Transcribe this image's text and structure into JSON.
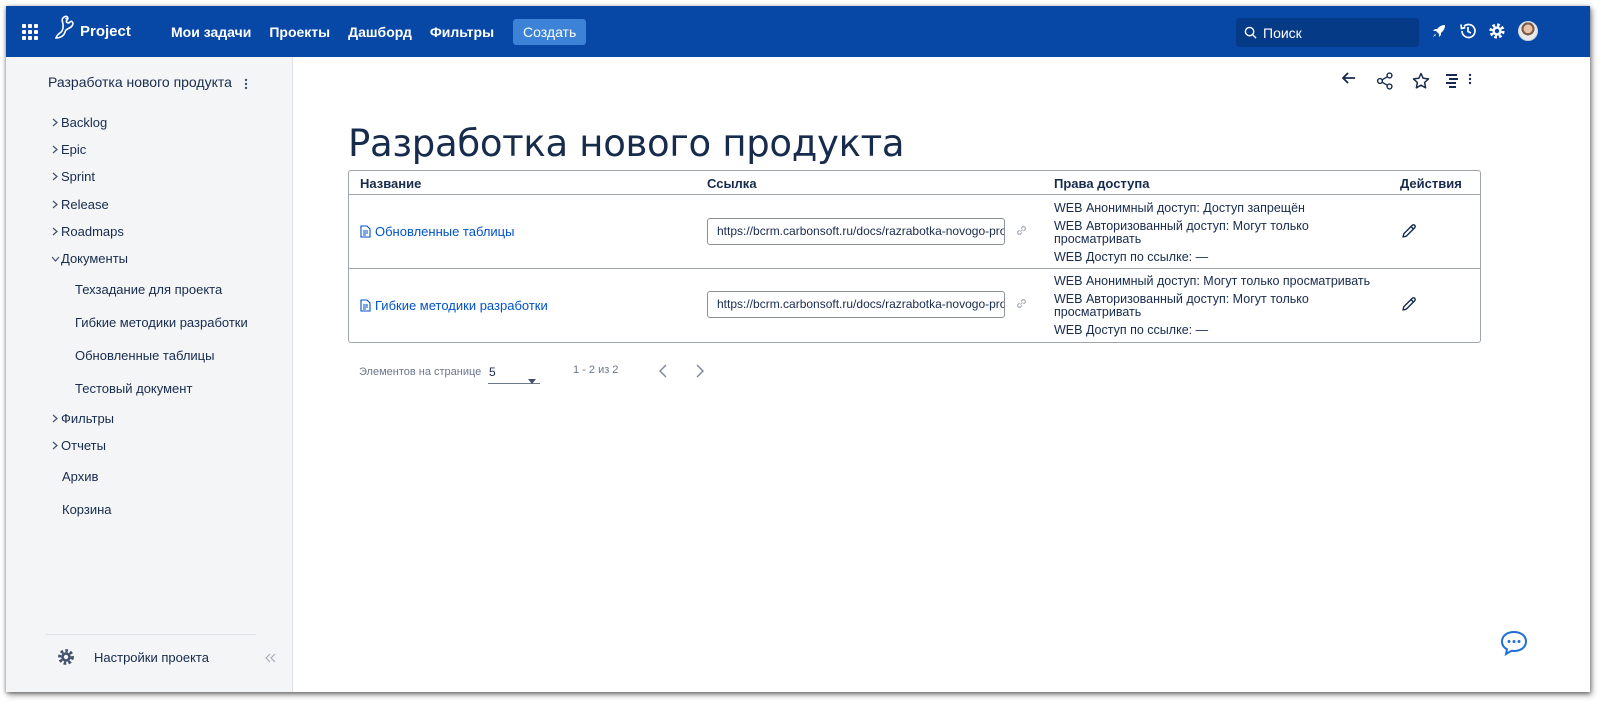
{
  "topbar": {
    "app_name": "Project",
    "nav": [
      "Мои задачи",
      "Проекты",
      "Дашборд",
      "Фильтры"
    ],
    "create_label": "Создать",
    "search_placeholder": "Поиск",
    "icons": [
      "apps-grid-icon",
      "rocket-icon",
      "history-icon",
      "gear-icon",
      "avatar"
    ],
    "colors": {
      "bar": "#0747a6",
      "create": "#3c82d6"
    }
  },
  "sidebar": {
    "project_title": "Разработка нового продукта",
    "tree": [
      {
        "label": "Backlog",
        "expanded": false
      },
      {
        "label": "Epic",
        "expanded": false
      },
      {
        "label": "Sprint",
        "expanded": false
      },
      {
        "label": "Release",
        "expanded": false
      },
      {
        "label": "Roadmaps",
        "expanded": false
      },
      {
        "label": "Документы",
        "expanded": true
      }
    ],
    "documents": [
      "Техзадание для проекта",
      "Гибкие методики разработки",
      "Обновленные таблицы",
      "Тестовый документ"
    ],
    "tree_after": [
      {
        "label": "Фильтры",
        "expanded": false
      },
      {
        "label": "Отчеты",
        "expanded": false
      }
    ],
    "plain": [
      "Архив",
      "Корзина"
    ],
    "settings_label": "Настройки проекта"
  },
  "main": {
    "title": "Разработка нового продукта",
    "toolbar_icons": [
      "back-arrow-icon",
      "share-icon",
      "star-icon",
      "list-view-icon",
      "more-vertical-icon"
    ],
    "table": {
      "headers": [
        "Название",
        "Ссылка",
        "Права доступа",
        "Действия"
      ],
      "rows": [
        {
          "name": "Обновленные таблицы",
          "link": "https://bcrm.carbonsoft.ru/docs/razrabotka-novogo-produkta/obnovlennye-tablicy",
          "perm_anon": "WEB Анонимный доступ: Доступ запрещён",
          "perm_auth": "WEB Авторизованный доступ: Могут только просматривать",
          "perm_link": "WEB Доступ по ссылке: —"
        },
        {
          "name": "Гибкие методики разработки",
          "link": "https://bcrm.carbonsoft.ru/docs/razrabotka-novogo-produkta/gibkie-metodiki-razrabotki",
          "perm_anon": "WEB Анонимный доступ: Могут только просматривать",
          "perm_auth": "WEB Авторизованный доступ: Могут только просматривать",
          "perm_link": "WEB Доступ по ссылке: —"
        }
      ]
    },
    "pager": {
      "per_page_label": "Элементов на странице",
      "per_page_value": "5",
      "range": "1 - 2 из 2"
    }
  }
}
